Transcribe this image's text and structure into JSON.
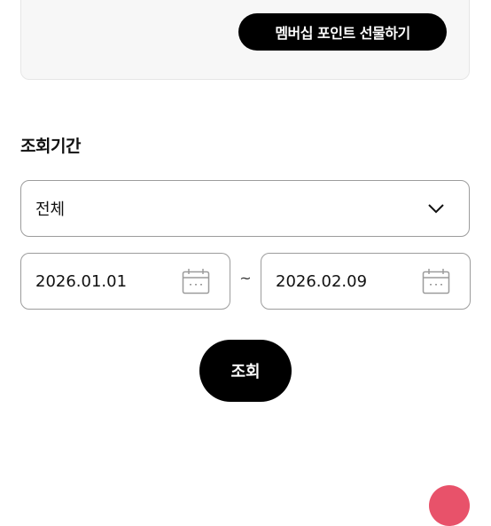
{
  "membership": {
    "gift_button_label": "멤버십 포인트 선물하기"
  },
  "period": {
    "title": "조회기간",
    "select": {
      "value": "전체",
      "icon": "chevron-down-icon"
    },
    "start_date": "2026.01.01",
    "separator": "~",
    "end_date": "2026.02.09",
    "calendar_icon": "calendar-icon"
  },
  "search_button_label": "조회",
  "colors": {
    "primary": "#000000",
    "card_bg": "#f7f7f7",
    "border": "#9c9c9c",
    "floating_accent": "#e8526a"
  }
}
